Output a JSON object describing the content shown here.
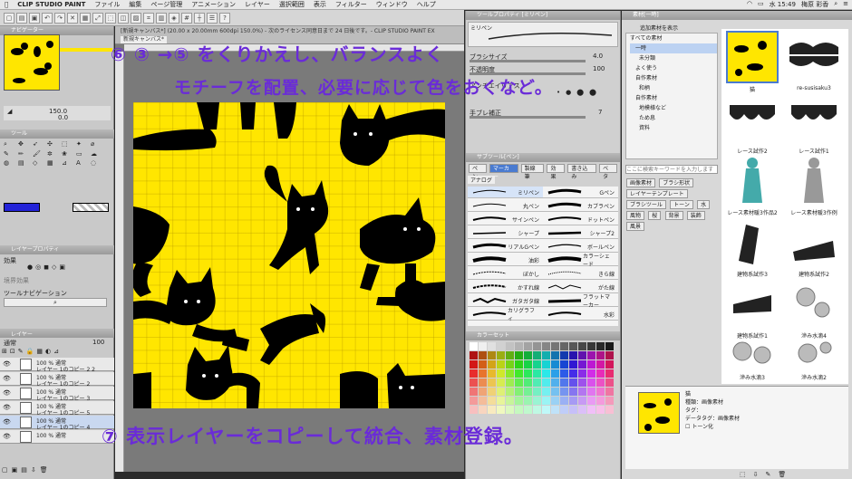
{
  "menubar": {
    "app": "CLIP STUDIO PAINT",
    "items": [
      "ファイル",
      "編集",
      "ページ管理",
      "アニメーション",
      "レイヤー",
      "選択範囲",
      "表示",
      "フィルター",
      "ウィンドウ",
      "ヘルプ"
    ],
    "clock": "水 15:49",
    "user": "梅原 彩香"
  },
  "document": {
    "window_title": "[新規キャンバス*] (20.00 x 20.00mm 600dpi 150.0%) - 次のライセンス同意日まで 24 日後です。- CLIP STUDIO PAINT EX",
    "tab1": "新規キャンバス*",
    "tab2": "新規キャン...",
    "subtab": "新規キャンバス*"
  },
  "left_panel": {
    "navigator_title": "ナビゲーター",
    "zoom": "150.0",
    "rotate": "0.0",
    "tool_title": "ツール",
    "layer_property_title": "レイヤープロパティ",
    "effect_label": "効果",
    "border_color_label": "境界効果",
    "tool_navigation_label": "ツールナビゲーション",
    "layer_tab": "レイヤー",
    "blend_mode": "通常",
    "opacity": "100",
    "layers": [
      {
        "pct": "100 % 通常",
        "name": "レイヤー 1のコピー 2 2"
      },
      {
        "pct": "100 % 通常",
        "name": "レイヤー 1のコピー 2"
      },
      {
        "pct": "100 % 通常",
        "name": "レイヤー 1のコピー 3"
      },
      {
        "pct": "100 % 通常",
        "name": "レイヤー 1のコピー 5"
      },
      {
        "pct": "100 % 通常",
        "name": "レイヤー 1のコピー 4"
      },
      {
        "pct": "100 % 通常",
        "name": ""
      }
    ]
  },
  "tool_property": {
    "title": "ツールプロパティ [ミリペン]",
    "brush_name": "ミリペン",
    "brush_size_label": "ブラシサイズ",
    "brush_size": "4.0",
    "opacity_label": "不透明度",
    "opacity": "100",
    "antialias_label": "アンチエイリアス",
    "stabilization_label": "手ブレ補正",
    "stabilization": "7"
  },
  "subtool": {
    "title": "サブツール[ペン]",
    "tabs": [
      "ペン",
      "マーカー",
      "製線筆",
      "効果",
      "書き込み",
      "ベタ"
    ],
    "group": "アナログ",
    "brushes": [
      [
        "ミリペン",
        "Gペン"
      ],
      [
        "丸ペン",
        "カブラペン"
      ],
      [
        "サインペン",
        "ドットペン"
      ],
      [
        "シャープ",
        "シャープ2"
      ],
      [
        "リアルGペン",
        "ボールペン"
      ],
      [
        "油彩",
        "カラーシェード"
      ],
      [
        "ぼかし",
        "きら線"
      ],
      [
        "かすれ線",
        "がた線"
      ],
      [
        "ガタガタ線",
        "フラットマーカー"
      ],
      [
        "カリグラフィ",
        "水彩"
      ]
    ]
  },
  "colorset": {
    "title": "カラーセット"
  },
  "materials": {
    "title": "素材[一時]",
    "add_label": "追加素材を表示",
    "tree": [
      "すべての素材",
      "一時",
      "未分類",
      "よく使う",
      "自作素材",
      "和柄",
      "自作素材",
      "地模様など",
      "ため息",
      "資料"
    ],
    "search_placeholder": "ここに検索キーワードを入力します",
    "tags": [
      "画像素材",
      "ブラシ形状",
      "レイヤーテンプレート",
      "ブラシツール",
      "トーン",
      "水",
      "風物",
      "桜",
      "背景",
      "装飾",
      "風景"
    ],
    "items": [
      {
        "label": "猫"
      },
      {
        "label": "re-susisaku3"
      },
      {
        "label": "レース試作2"
      },
      {
        "label": "レース試作1"
      },
      {
        "label": "レース素材暖3作品2"
      },
      {
        "label": "レース素材暖3作例"
      },
      {
        "label": "建物系試作3"
      },
      {
        "label": "建物系試作2"
      },
      {
        "label": "建物系試作1"
      },
      {
        "label": "滲み水滴4"
      },
      {
        "label": "滲み水滴3"
      },
      {
        "label": "滲み水滴2"
      }
    ],
    "detail": {
      "name": "猫",
      "kind": "種類：画像素材",
      "tag": "タグ：",
      "data_tag": "データタグ：画像素材",
      "tone_label": "トーン化"
    }
  },
  "annotations": {
    "line1": "⑥ ③ →⑤ をくりかえし、バランスよく",
    "line2": "モチーフを配置、必要に応じて色をおくなど。",
    "line3": "⑦ 表示レイヤーをコピーして統合、素材登録。",
    "ink_color": "#6a2bd8"
  },
  "colors": {
    "canvas_bg": "#ffe600",
    "motif": "#000000",
    "panel": "#d0d0d0"
  }
}
